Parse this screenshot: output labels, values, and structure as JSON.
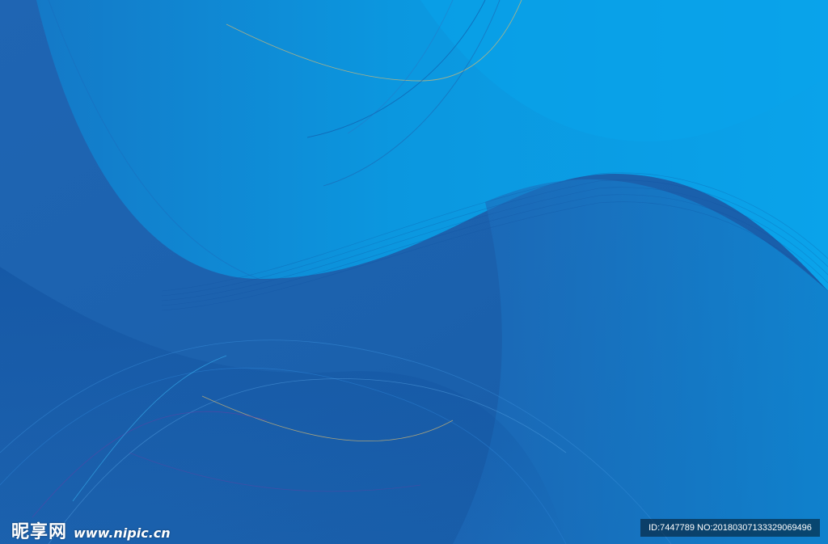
{
  "background": {
    "description_colors": {
      "deep_blue": "#1d5fae",
      "mid_blue": "#1478c8",
      "light_blue": "#09a2e8",
      "accent_gold": "#d7b970",
      "accent_purple": "#6b3ea5"
    }
  },
  "watermark": {
    "site_name_cn": "昵享网",
    "site_url": "www.nipic.cn",
    "image_id": "ID:7447789 NO:20180307133329069496"
  }
}
